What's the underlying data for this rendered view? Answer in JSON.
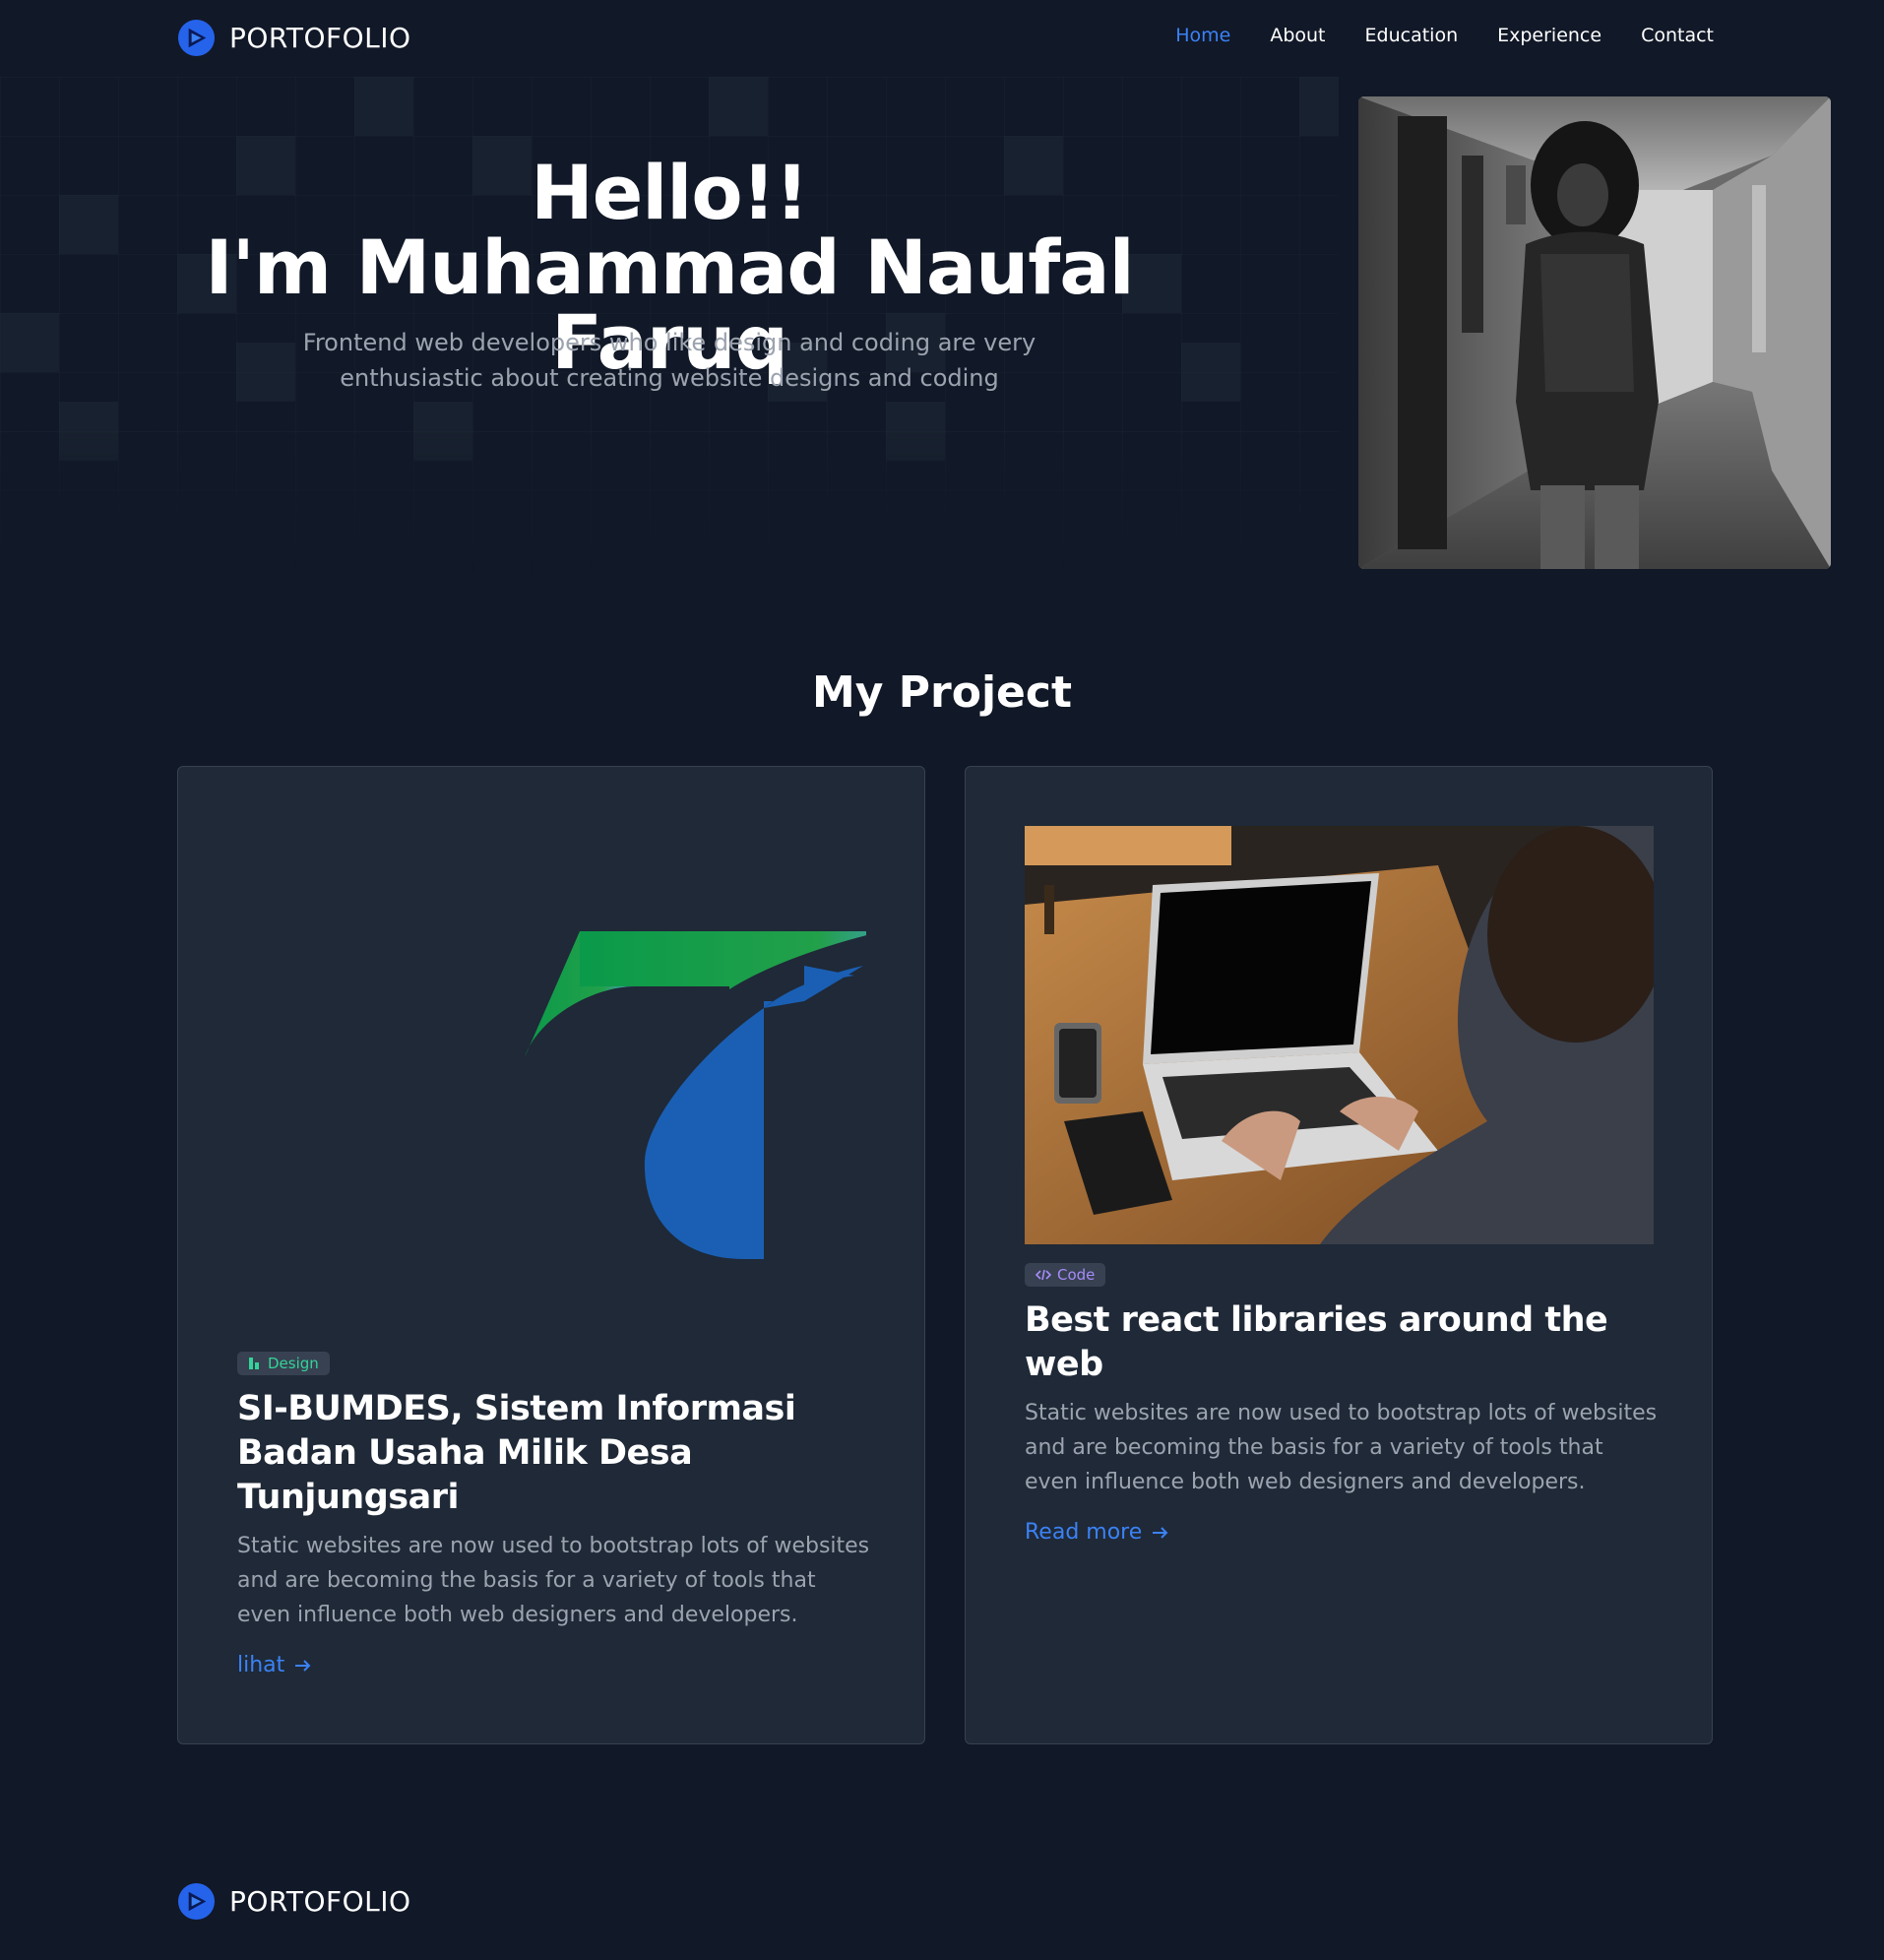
{
  "brand": {
    "name": "PORTOFOLIO",
    "logo_icon": "portfolio-logo-icon",
    "accent_color": "#3b82f6"
  },
  "nav": {
    "links": [
      {
        "label": "Home",
        "active": true
      },
      {
        "label": "About",
        "active": false
      },
      {
        "label": "Education",
        "active": false
      },
      {
        "label": "Experience",
        "active": false
      },
      {
        "label": "Contact",
        "active": false
      }
    ]
  },
  "hero": {
    "greeting": "Hello!!",
    "name_line": "I'm Muhammad Naufal Faruq",
    "subtitle": "Frontend web developers who like design and coding are very enthusiastic about creating website designs and coding"
  },
  "projects": {
    "section_title": "My Project",
    "cards": [
      {
        "badge": "Design",
        "badge_icon": "design-icon",
        "title": "SI-BUMDES, Sistem Informasi Badan Usaha Milik Desa Tunjungsari",
        "description": "Static websites are now used to bootstrap lots of websites and are becoming the basis for a variety of tools that even influence both web designers and developers.",
        "link_label": "lihat"
      },
      {
        "badge": "Code",
        "badge_icon": "code-icon",
        "title": "Best react libraries around the web",
        "description": "Static websites are now used to bootstrap lots of websites and are becoming the basis for a variety of tools that even influence both web designers and developers.",
        "link_label": "Read more"
      }
    ]
  },
  "footer": {
    "brand_name": "PORTOFOLIO"
  },
  "colors": {
    "background": "#111827",
    "card": "#1f2937",
    "muted_text": "#9ca3af",
    "link": "#3b82f6"
  }
}
